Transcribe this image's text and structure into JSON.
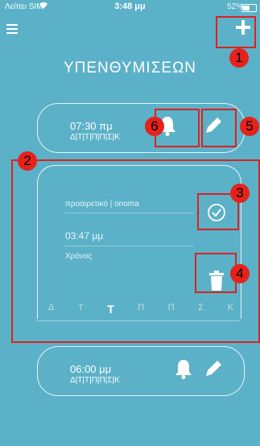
{
  "status": {
    "carrier": "Λείπει SIM",
    "time": "3:48 μμ",
    "battery": "52%"
  },
  "header": {
    "title": "ΥΠΕΝΘΥΜΙΣΕΩΝ"
  },
  "reminders": [
    {
      "time": "07:30 πμ",
      "days": "Δ|Τ|Τ|Π|Π|Σ|Κ"
    },
    {
      "time": "06:00 μμ",
      "days": "Δ|Τ|Τ|Π|Π|Σ|Κ"
    }
  ],
  "edit": {
    "name_field": "προαιρετικό | onoma",
    "time_field": "03:47 μμ",
    "label_field": "Χρόνος",
    "weekdays": [
      "Δ",
      "Τ",
      "Τ",
      "Π",
      "Π",
      "Σ",
      "Κ"
    ]
  },
  "annotations": [
    "1",
    "2",
    "3",
    "4",
    "5",
    "6"
  ],
  "colors": {
    "background": "#5bb1c8",
    "annotation": "#d9231f"
  }
}
